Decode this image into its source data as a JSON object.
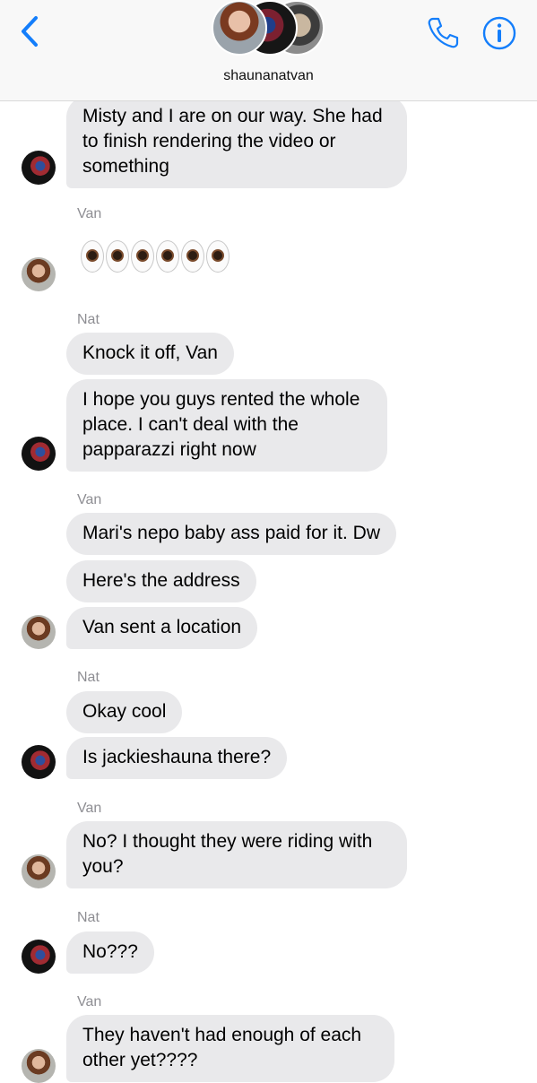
{
  "header": {
    "group_name": "shaunanatvan",
    "icons": {
      "back": "chevron-left-icon",
      "call": "phone-icon",
      "info": "info-icon"
    },
    "accent": "#147efb"
  },
  "colors": {
    "bubble": "#e9e9eb",
    "label": "#8e8e93"
  },
  "messages": [
    {
      "text": "Misty and I are on our way. She had to finish rendering the video or something"
    },
    {
      "sender": "Van",
      "emoji_count": 6,
      "emoji": "eyes-icon"
    },
    {
      "sender": "Nat",
      "text": "Knock it off, Van"
    },
    {
      "text": "I hope you guys rented the whole place. I can't deal with the papparazzi right now"
    },
    {
      "sender": "Van",
      "text": "Mari's nepo baby ass paid for it. Dw"
    },
    {
      "text": "Here's the address"
    },
    {
      "text": "Van sent a location"
    },
    {
      "sender": "Nat",
      "text": "Okay cool"
    },
    {
      "text": "Is jackieshauna there?"
    },
    {
      "sender": "Van",
      "text": "No? I thought they were riding with you?"
    },
    {
      "sender": "Nat",
      "text": "No???"
    },
    {
      "sender": "Van",
      "text": "They haven't had enough of each other yet????"
    }
  ]
}
